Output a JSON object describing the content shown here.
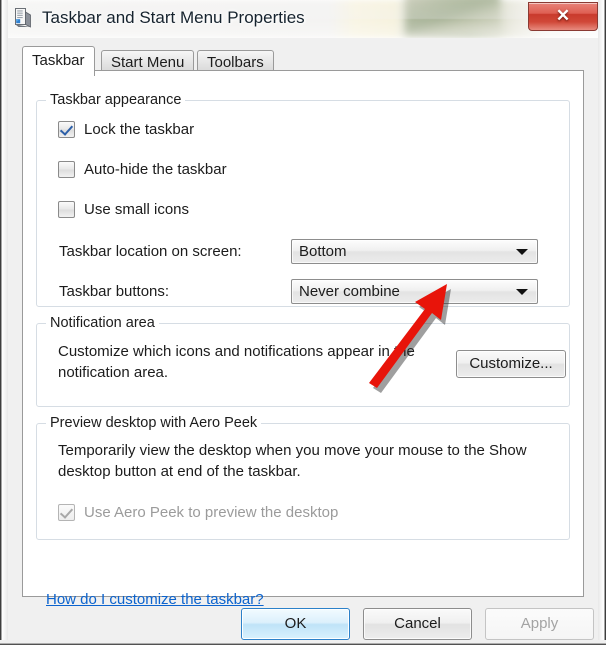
{
  "window": {
    "title": "Taskbar and Start Menu Properties",
    "icon": "computer-monitor-icon",
    "close_label": "✕"
  },
  "tabs": [
    {
      "label": "Taskbar",
      "selected": true
    },
    {
      "label": "Start Menu",
      "selected": false
    },
    {
      "label": "Toolbars",
      "selected": false
    }
  ],
  "taskbar_appearance": {
    "group_title": "Taskbar appearance",
    "checkboxes": [
      {
        "label": "Lock the taskbar",
        "checked": true,
        "disabled": false
      },
      {
        "label": "Auto-hide the taskbar",
        "checked": false,
        "disabled": false
      },
      {
        "label": "Use small icons",
        "checked": false,
        "disabled": false
      }
    ],
    "location_label": "Taskbar location on screen:",
    "location_value": "Bottom",
    "buttons_label": "Taskbar buttons:",
    "buttons_value": "Never combine"
  },
  "notification_area": {
    "group_title": "Notification area",
    "description": "Customize which icons and notifications appear in the notification area.",
    "customize_label": "Customize..."
  },
  "aero_peek": {
    "group_title": "Preview desktop with Aero Peek",
    "description": "Temporarily view the desktop when you move your mouse to the Show desktop button at end of the taskbar.",
    "checkbox_label": "Use Aero Peek to preview the desktop",
    "checkbox_checked": true,
    "checkbox_disabled": true
  },
  "help_link": "How do I customize the taskbar?",
  "footer": {
    "ok_label": "OK",
    "cancel_label": "Cancel",
    "apply_label": "Apply",
    "apply_disabled": true
  },
  "annotation": {
    "type": "arrow",
    "color": "#e8140a",
    "points_to": "Taskbar buttons dropdown"
  },
  "colors": {
    "link": "#0b63ce",
    "checkmark": "#2c5fa8",
    "annotation_red": "#e8140a",
    "close_red": "#c93a2c"
  }
}
